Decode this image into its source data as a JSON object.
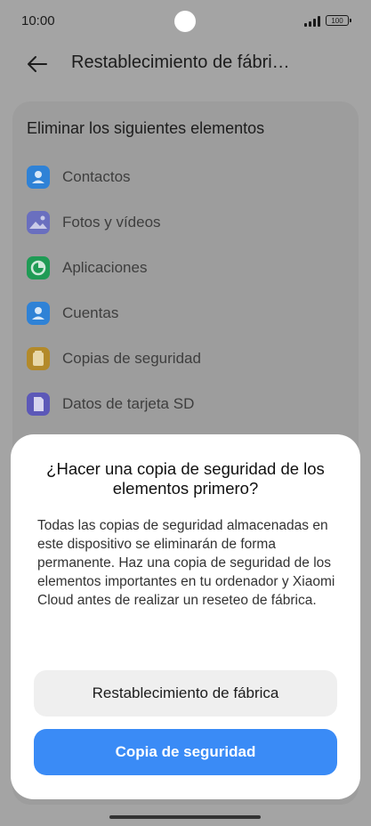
{
  "status_bar": {
    "time": "10:00",
    "battery": "100"
  },
  "header": {
    "title": "Restablecimiento de fábri…",
    "back_icon": "arrow-left-icon"
  },
  "card": {
    "title": "Eliminar los siguientes elementos",
    "items": [
      {
        "label": "Contactos",
        "icon": "contacts-icon",
        "color": "#2f82d6"
      },
      {
        "label": "Fotos y vídeos",
        "icon": "photos-icon",
        "color": "#6a6fbf"
      },
      {
        "label": "Aplicaciones",
        "icon": "apps-icon",
        "color": "#1f9b55"
      },
      {
        "label": "Cuentas",
        "icon": "accounts-icon",
        "color": "#2f82d6"
      },
      {
        "label": "Copias de seguridad",
        "icon": "backup-icon",
        "color": "#b38a2a"
      },
      {
        "label": "Datos de tarjeta SD",
        "icon": "sd-card-icon",
        "color": "#5c58b8"
      }
    ]
  },
  "dialog": {
    "title": "¿Hacer una copia de seguridad de los elementos primero?",
    "body": "Todas las copias de seguridad almacenadas en este dispositivo se eliminarán de forma permanente. Haz una copia de seguridad de los elementos importantes en tu ordenador y Xiaomi Cloud antes de realizar un reseteo de fábrica.",
    "secondary_button": "Restablecimiento de fábrica",
    "primary_button": "Copia de seguridad"
  },
  "colors": {
    "primary": "#3a8bf6",
    "scrim": "#a4a4a4"
  }
}
